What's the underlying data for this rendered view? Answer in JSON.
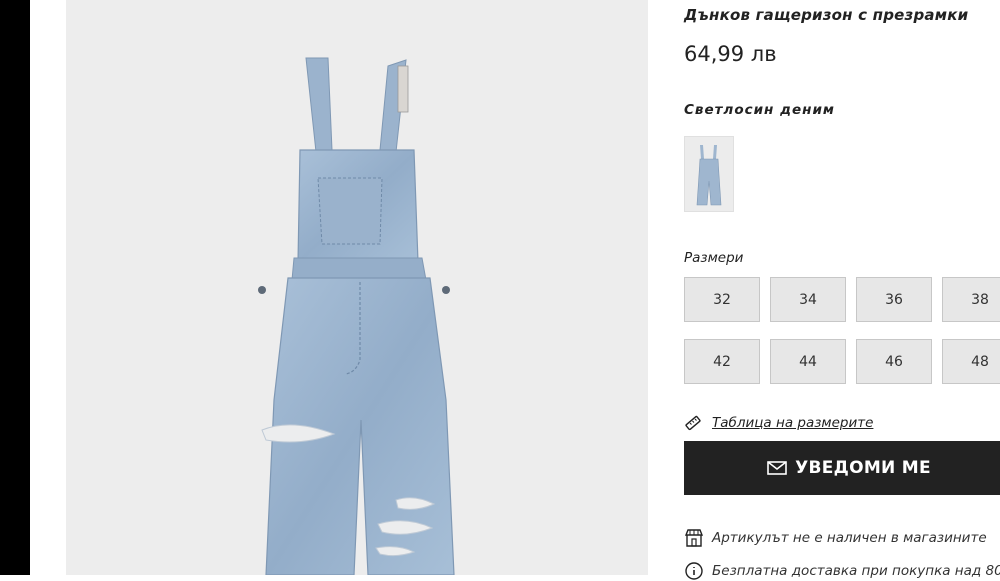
{
  "product": {
    "title": "Дънков гащеризон с презрамки",
    "price": "64,99 лв",
    "color_name": "Светлосин деним",
    "swatch_color": "#9fb6cf",
    "image_description_icon": "denim-overalls-image"
  },
  "sizes": {
    "label": "Размери",
    "options": [
      "32",
      "34",
      "36",
      "38",
      "42",
      "44",
      "46",
      "48"
    ]
  },
  "size_guide": {
    "label": "Таблица на размерите",
    "icon": "ruler-icon"
  },
  "notify_button": {
    "label": "УВЕДОМИ МЕ",
    "icon": "envelope-icon"
  },
  "availability": {
    "store_text": "Артикулът не е наличен в магазините",
    "store_icon": "store-icon",
    "delivery_text": "Безплатна доставка при покупка над 80",
    "delivery_icon": "info-icon"
  },
  "colors": {
    "denim": "#9cb5cf",
    "button_bg": "#222222",
    "size_bg": "#e7e7e7"
  }
}
